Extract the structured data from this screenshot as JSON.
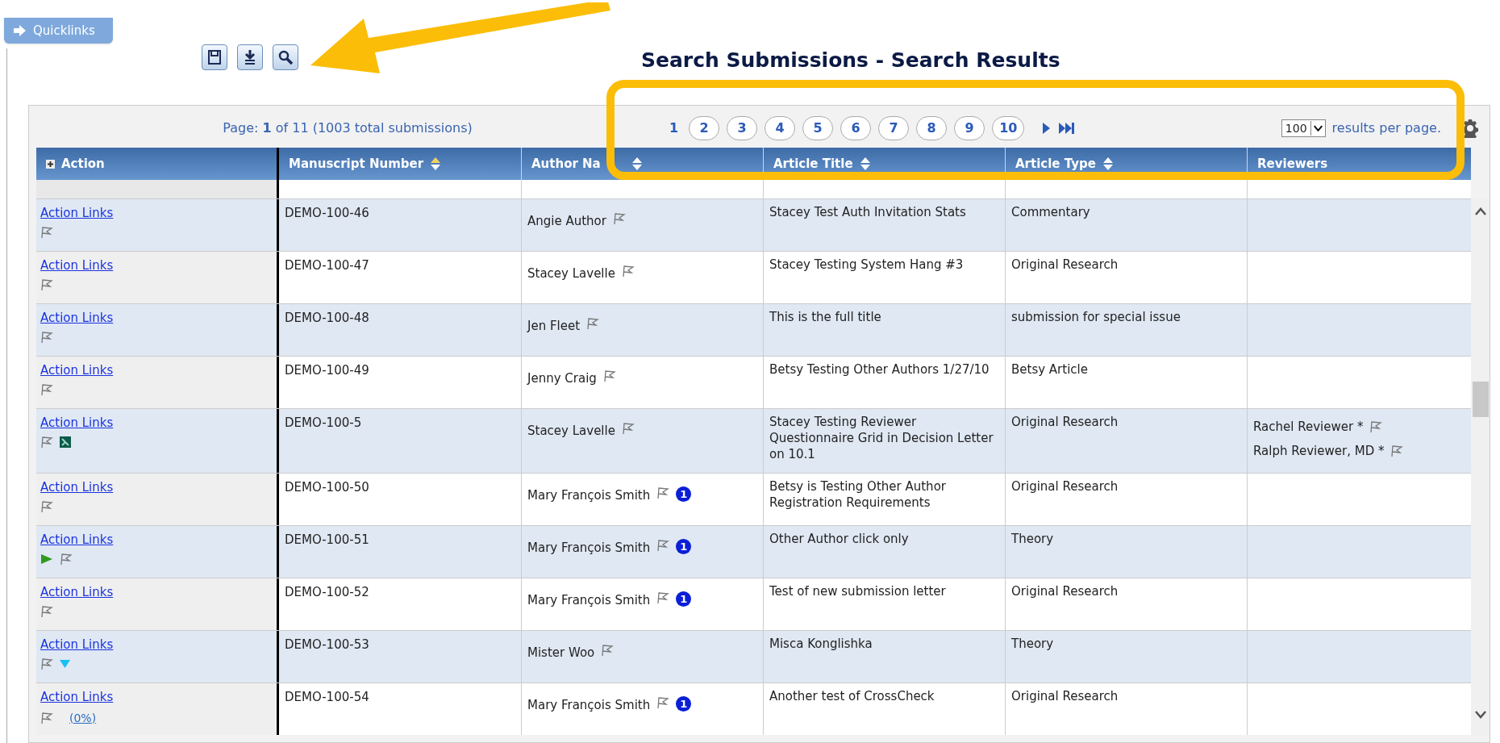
{
  "quicklinks": {
    "label": "Quicklinks"
  },
  "title": "Search Submissions - Search Results",
  "toolbar": [
    {
      "kind": "save"
    },
    {
      "kind": "download"
    },
    {
      "kind": "search"
    }
  ],
  "pager": {
    "summary": "Page: **1** of 11 (1003 total submissions)",
    "pages": [
      {
        "label": "1",
        "selected": true
      },
      {
        "label": "2",
        "selected": false
      },
      {
        "label": "3",
        "selected": false
      },
      {
        "label": "4",
        "selected": false
      },
      {
        "label": "5",
        "selected": false
      },
      {
        "label": "6",
        "selected": false
      },
      {
        "label": "7",
        "selected": false
      },
      {
        "label": "8",
        "selected": false
      },
      {
        "label": "9",
        "selected": false
      },
      {
        "label": "10",
        "selected": false
      }
    ],
    "per_page": "100",
    "per_page_label": "results per page."
  },
  "table": {
    "columns": [
      {
        "label": "Action",
        "kind": "expand"
      },
      {
        "label": "Manuscript Number",
        "kind": "sorted"
      },
      {
        "label": "Author Na",
        "kind": "sortable"
      },
      {
        "label": "Article Title",
        "kind": "sortable"
      },
      {
        "label": "Article Type",
        "kind": "sortable"
      },
      {
        "label": "Reviewers",
        "kind": "plain"
      }
    ],
    "rows": [
      {
        "action": "Action Links",
        "marks": [
          {
            "kind": "flag"
          }
        ],
        "manuscript": "DEMO-100-46",
        "author": "Angie Author",
        "title": "Stacey Test Auth Invitation Stats",
        "type": "Commentary",
        "reviewers": []
      },
      {
        "action": "Action Links",
        "marks": [
          {
            "kind": "flag"
          }
        ],
        "manuscript": "DEMO-100-47",
        "author": "Stacey Lavelle",
        "title": "Stacey Testing System Hang #3",
        "type": "Original Research",
        "reviewers": []
      },
      {
        "action": "Action Links",
        "marks": [
          {
            "kind": "flag"
          }
        ],
        "manuscript": "DEMO-100-48",
        "author": "Jen Fleet",
        "title": "This is the full title",
        "type": "submission for special issue",
        "reviewers": []
      },
      {
        "action": "Action Links",
        "marks": [
          {
            "kind": "flag"
          }
        ],
        "manuscript": "DEMO-100-49",
        "author": "Jenny Craig",
        "title": "Betsy Testing Other Authors 1/27/10",
        "type": "Betsy Article",
        "reviewers": []
      },
      {
        "action": "Action Links",
        "marks": [
          {
            "kind": "flag"
          },
          {
            "kind": "document"
          }
        ],
        "manuscript": "DEMO-100-5",
        "author": "Stacey Lavelle",
        "title": "Stacey Testing Reviewer Questionnaire Grid in Decision Letter on 10.1",
        "type": "Original Research",
        "reviewers": [
          "Rachel Reviewer *",
          "Ralph Reviewer, MD *"
        ]
      },
      {
        "action": "Action Links",
        "marks": [
          {
            "kind": "flag"
          }
        ],
        "manuscript": "DEMO-100-50",
        "author": "Mary François Smith",
        "badge": "1",
        "title": "Betsy is Testing Other Author Registration Requirements",
        "type": "Original Research",
        "reviewers": []
      },
      {
        "action": "Action Links",
        "marks": [
          {
            "kind": "play"
          },
          {
            "kind": "flag"
          }
        ],
        "manuscript": "DEMO-100-51",
        "author": "Mary François Smith",
        "badge": "1",
        "title": "Other Author click only",
        "type": "Theory",
        "reviewers": []
      },
      {
        "action": "Action Links",
        "marks": [
          {
            "kind": "flag"
          }
        ],
        "manuscript": "DEMO-100-52",
        "author": "Mary François Smith",
        "badge": "1",
        "title": "Test of new submission letter",
        "type": "Original Research",
        "reviewers": []
      },
      {
        "action": "Action Links",
        "marks": [
          {
            "kind": "flag"
          },
          {
            "kind": "triangle"
          }
        ],
        "manuscript": "DEMO-100-53",
        "author": "Mister Woo",
        "title": "Misca Konglishka",
        "type": "Theory",
        "reviewers": []
      },
      {
        "action": "Action Links",
        "marks": [
          {
            "kind": "flag"
          },
          {
            "kind": "link",
            "text": "(0%)"
          }
        ],
        "manuscript": "DEMO-100-54",
        "author": "Mary François Smith",
        "badge": "1",
        "title": "Another test of CrossCheck",
        "type": "Original Research",
        "reviewers": []
      }
    ]
  }
}
